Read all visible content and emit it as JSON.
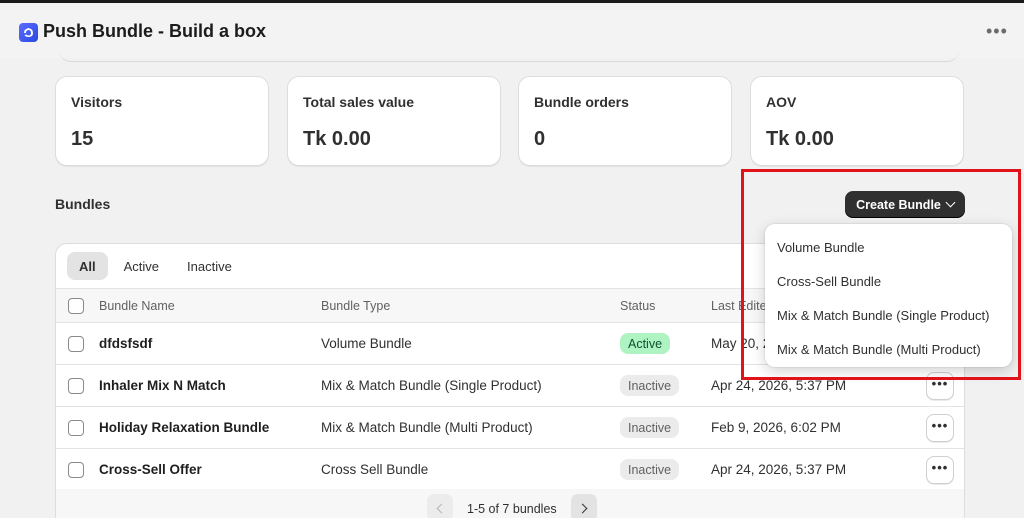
{
  "app": {
    "title": "Push Bundle - Build a box",
    "more_label": "•••",
    "icon": "app-logo-icon",
    "brand_color": "#3b5bfd"
  },
  "stats": [
    {
      "label": "Visitors",
      "value": "15"
    },
    {
      "label": "Total sales value",
      "value": "Tk 0.00"
    },
    {
      "label": "Bundle orders",
      "value": "0"
    },
    {
      "label": "AOV",
      "value": "Tk 0.00"
    }
  ],
  "bundles": {
    "title": "Bundles",
    "create_label": "Create Bundle",
    "tabs": [
      {
        "label": "All",
        "selected": true
      },
      {
        "label": "Active",
        "selected": false
      },
      {
        "label": "Inactive",
        "selected": false
      }
    ],
    "columns": {
      "name": "Bundle Name",
      "type": "Bundle Type",
      "status": "Status",
      "edited": "Last Edite"
    },
    "rows": [
      {
        "name": "dfdsfsdf",
        "type": "Volume Bundle",
        "status": "Active",
        "edited": "May 20, 2"
      },
      {
        "name": "Inhaler Mix N Match",
        "type": "Mix & Match Bundle (Single Product)",
        "status": "Inactive",
        "edited": "Apr 24, 2026, 5:37 PM"
      },
      {
        "name": "Holiday Relaxation Bundle",
        "type": "Mix & Match Bundle (Multi Product)",
        "status": "Inactive",
        "edited": "Feb 9, 2026, 6:02 PM"
      },
      {
        "name": "Cross-Sell Offer",
        "type": "Cross Sell Bundle",
        "status": "Inactive",
        "edited": "Apr 24, 2026, 5:37 PM"
      }
    ],
    "row_more_label": "•••",
    "pagination": "1-5 of 7 bundles"
  },
  "dropdown": {
    "items": [
      "Volume Bundle",
      "Cross-Sell Bundle",
      "Mix & Match Bundle (Single Product)",
      "Mix & Match Bundle (Multi Product)"
    ]
  },
  "colors": {
    "active_badge": "#aff3c2",
    "inactive_badge": "#ebebeb",
    "primary_button": "#303030",
    "highlight": "#e0131b"
  }
}
